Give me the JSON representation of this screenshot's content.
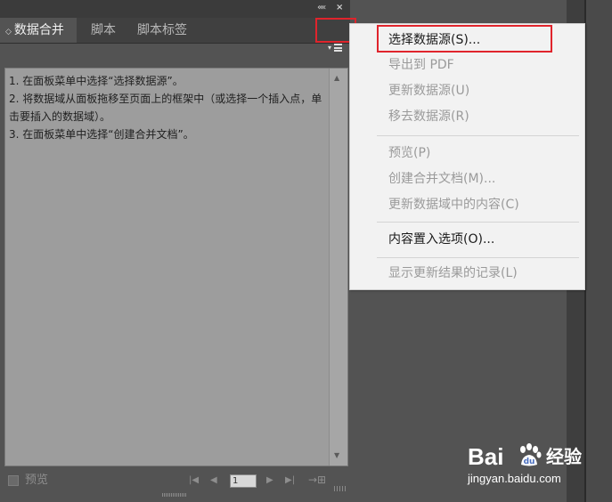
{
  "panel": {
    "topbar": {
      "collapse_icon": "««",
      "close_icon": "×"
    },
    "tabs": [
      {
        "label": "数据合并",
        "active": true
      },
      {
        "label": "脚本",
        "active": false
      },
      {
        "label": "脚本标签",
        "active": false
      }
    ],
    "tab_arrow": "◇",
    "menu_icon": "panel-menu-icon",
    "instructions": [
      "1. 在面板菜单中选择“选择数据源”。",
      "2. 将数据域从面板拖移至页面上的框架中（或选择一个插入点，单击要插入的数据域）。",
      "3. 在面板菜单中选择“创建合并文档”。"
    ],
    "scroll_up": "▲",
    "scroll_down": "▼",
    "status": {
      "preview_label": "预览",
      "nav_first": "|◀",
      "nav_prev": "◀",
      "page_value": "1",
      "nav_next": "▶",
      "nav_last": "▶|",
      "create_merged": "→⊞"
    }
  },
  "flyout_menu": {
    "items": [
      {
        "label": "选择数据源(S)...",
        "enabled": true
      },
      {
        "label": "导出到 PDF",
        "enabled": false
      },
      {
        "label": "更新数据源(U)",
        "enabled": false
      },
      {
        "label": "移去数据源(R)",
        "enabled": false
      },
      {
        "label": "预览(P)",
        "enabled": false
      },
      {
        "label": "创建合并文档(M)...",
        "enabled": false
      },
      {
        "label": "更新数据域中的内容(C)",
        "enabled": false
      },
      {
        "label": "内容置入选项(O)...",
        "enabled": true
      },
      {
        "label": "显示更新结果的记录(L)",
        "enabled": false
      }
    ]
  },
  "watermark": {
    "brand": "Bai",
    "brand_suffix": "经验",
    "url": "jingyan.baidu.com"
  },
  "colors": {
    "highlight": "#e0242c",
    "panel_bg": "#535353",
    "content_bg": "#9d9d9d",
    "menu_bg": "#f2f2f2"
  }
}
